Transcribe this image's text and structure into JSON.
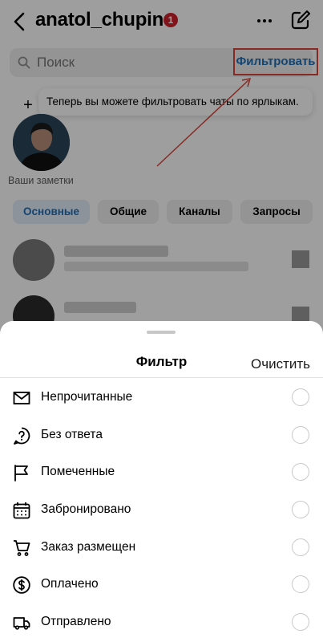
{
  "header": {
    "username": "anatol_chupin",
    "badge_count": "1"
  },
  "search": {
    "placeholder": "Поиск",
    "filter_label": "Фильтровать"
  },
  "tooltip": {
    "text": "Теперь вы можете фильтровать чаты по ярлыкам."
  },
  "notes": {
    "label": "Ваши заметки"
  },
  "tabs": [
    {
      "label": "Основные"
    },
    {
      "label": "Общие"
    },
    {
      "label": "Каналы"
    },
    {
      "label": "Запросы"
    }
  ],
  "sheet": {
    "title": "Фильтр",
    "clear_label": "Очистить",
    "options": [
      {
        "label": "Непрочитанные",
        "icon": "envelope-icon"
      },
      {
        "label": "Без ответа",
        "icon": "question-icon"
      },
      {
        "label": "Помеченные",
        "icon": "flag-icon"
      },
      {
        "label": "Забронировано",
        "icon": "calendar-icon"
      },
      {
        "label": "Заказ размещен",
        "icon": "cart-icon"
      },
      {
        "label": "Оплачено",
        "icon": "dollar-icon"
      },
      {
        "label": "Отправлено",
        "icon": "truck-icon"
      }
    ]
  },
  "colors": {
    "accent": "#1f6fb8",
    "highlight_border": "#d9443b",
    "badge": "#d0202c"
  }
}
